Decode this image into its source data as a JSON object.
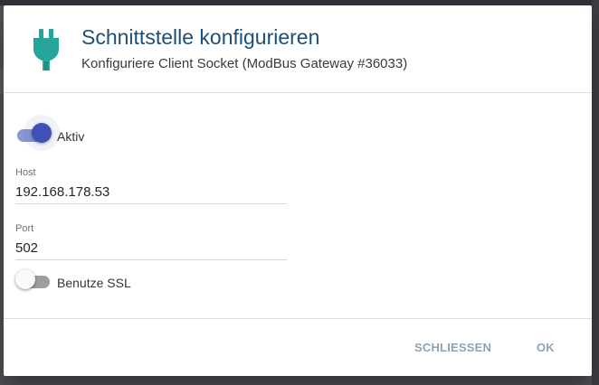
{
  "dialog": {
    "title": "Schnittstelle konfigurieren",
    "subtitle": "Konfiguriere Client Socket (ModBus Gateway #36033)",
    "icon": "plug-icon",
    "icon_color": "#26a69a"
  },
  "form": {
    "active_toggle": {
      "label": "Aktiv",
      "checked": true
    },
    "host": {
      "label": "Host",
      "value": "192.168.178.53"
    },
    "port": {
      "label": "Port",
      "value": "502"
    },
    "ssl_toggle": {
      "label": "Benutze SSL",
      "checked": false
    }
  },
  "actions": {
    "close_label": "SCHLIESSEN",
    "ok_label": "OK"
  },
  "colors": {
    "title": "#1d4f77",
    "toggle_on": "#3f51b5",
    "button_text": "#8fa3b8"
  }
}
